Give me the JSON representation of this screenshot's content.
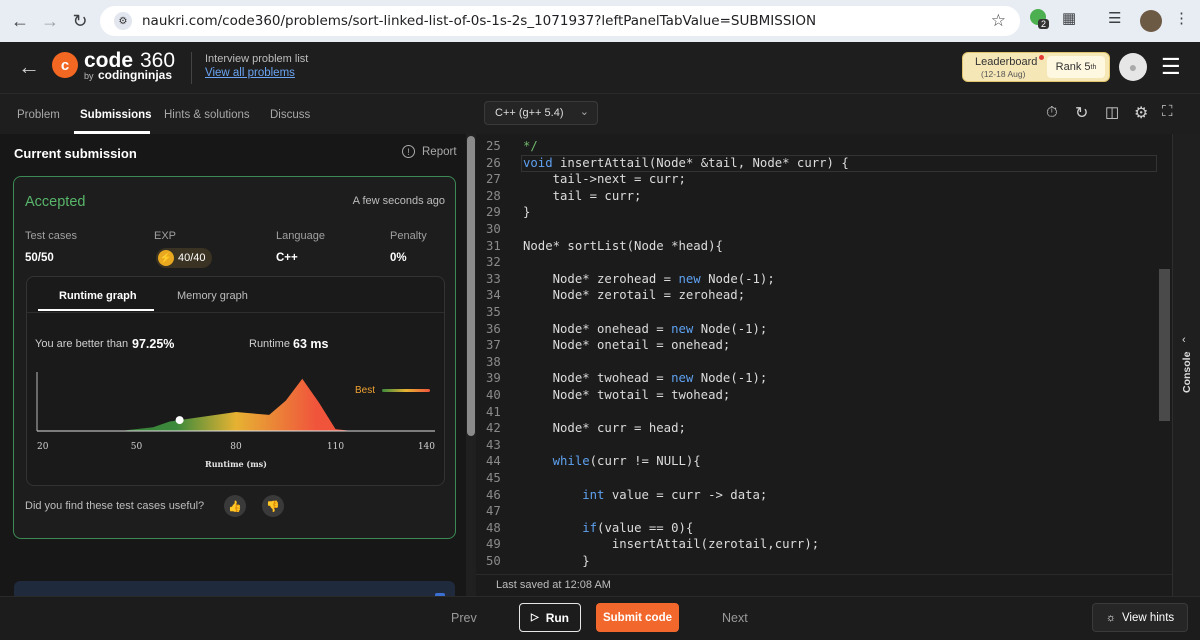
{
  "browser": {
    "url": "naukri.com/code360/problems/sort-linked-list-of-0s-1s-2s_1071937?leftPanelTabValue=SUBMISSION",
    "ext_badge": "2"
  },
  "header": {
    "logo_main": "code",
    "logo_num": "360",
    "logo_by": "by",
    "logo_brand": "codingninjas",
    "list_label": "Interview problem list",
    "view_all": "View all problems",
    "leaderboard_label": "Leaderboard",
    "leaderboard_dates": "(12-18 Aug)",
    "rank_label": "Rank",
    "rank_value": "5",
    "rank_suffix": "th"
  },
  "tabs": {
    "problem": "Problem",
    "submissions": "Submissions",
    "hints": "Hints & solutions",
    "discuss": "Discuss"
  },
  "language_select": "C++ (g++ 5.4)",
  "submission": {
    "section_title": "Current submission",
    "report": "Report",
    "status": "Accepted",
    "time_ago": "A few seconds ago",
    "stats": [
      {
        "label": "Test cases",
        "value": "50/50"
      },
      {
        "label": "EXP",
        "value": "40/40"
      },
      {
        "label": "Language",
        "value": "C++"
      },
      {
        "label": "Penalty",
        "value": "0%"
      }
    ],
    "graph_tabs": [
      "Runtime graph",
      "Memory graph"
    ],
    "better_than_label": "You are better than",
    "better_than_value": "97.25%",
    "runtime_label": "Runtime",
    "runtime_value": "63 ms",
    "best_label": "Best",
    "feedback_question": "Did you find these test cases useful?"
  },
  "chart_data": {
    "type": "area",
    "xlabel": "Runtime (ms)",
    "xlim": [
      20,
      140
    ],
    "x_ticks": [
      "20",
      "50",
      "80",
      "110",
      "140"
    ],
    "series": [
      {
        "x": [
          20,
          45,
          55,
          60,
          70,
          80,
          90,
          95,
          100,
          105,
          110,
          115,
          140
        ],
        "y": [
          0,
          0,
          4,
          10,
          15,
          20,
          17,
          32,
          55,
          30,
          2,
          0,
          0
        ]
      }
    ],
    "user_marker_x": 63,
    "colors": {
      "low": "#3c8a3c",
      "mid": "#e6b232",
      "high": "#f0553c"
    }
  },
  "editor": {
    "last_saved": "Last saved at 12:08 AM",
    "lines": [
      {
        "n": "25",
        "t": "*/"
      },
      {
        "n": "26",
        "t": "void insertAttail(Node* &tail, Node* curr) {"
      },
      {
        "n": "27",
        "t": "    tail->next = curr;"
      },
      {
        "n": "28",
        "t": "    tail = curr;"
      },
      {
        "n": "29",
        "t": "}"
      },
      {
        "n": "30",
        "t": ""
      },
      {
        "n": "31",
        "t": "Node* sortList(Node *head){"
      },
      {
        "n": "32",
        "t": ""
      },
      {
        "n": "33",
        "t": "    Node* zerohead = new Node(-1);"
      },
      {
        "n": "34",
        "t": "    Node* zerotail = zerohead;"
      },
      {
        "n": "35",
        "t": ""
      },
      {
        "n": "36",
        "t": "    Node* onehead = new Node(-1);"
      },
      {
        "n": "37",
        "t": "    Node* onetail = onehead;"
      },
      {
        "n": "38",
        "t": ""
      },
      {
        "n": "39",
        "t": "    Node* twohead = new Node(-1);"
      },
      {
        "n": "40",
        "t": "    Node* twotail = twohead;"
      },
      {
        "n": "41",
        "t": ""
      },
      {
        "n": "42",
        "t": "    Node* curr = head;"
      },
      {
        "n": "43",
        "t": ""
      },
      {
        "n": "44",
        "t": "    while(curr != NULL){"
      },
      {
        "n": "45",
        "t": ""
      },
      {
        "n": "46",
        "t": "        int value = curr -> data;"
      },
      {
        "n": "47",
        "t": ""
      },
      {
        "n": "48",
        "t": "        if(value == 0){"
      },
      {
        "n": "49",
        "t": "            insertAttail(zerotail,curr);"
      },
      {
        "n": "50",
        "t": "        }"
      }
    ]
  },
  "console_label": "Console",
  "bottom": {
    "prev": "Prev",
    "run": "Run",
    "submit": "Submit code",
    "next": "Next",
    "view_hints": "View hints"
  }
}
